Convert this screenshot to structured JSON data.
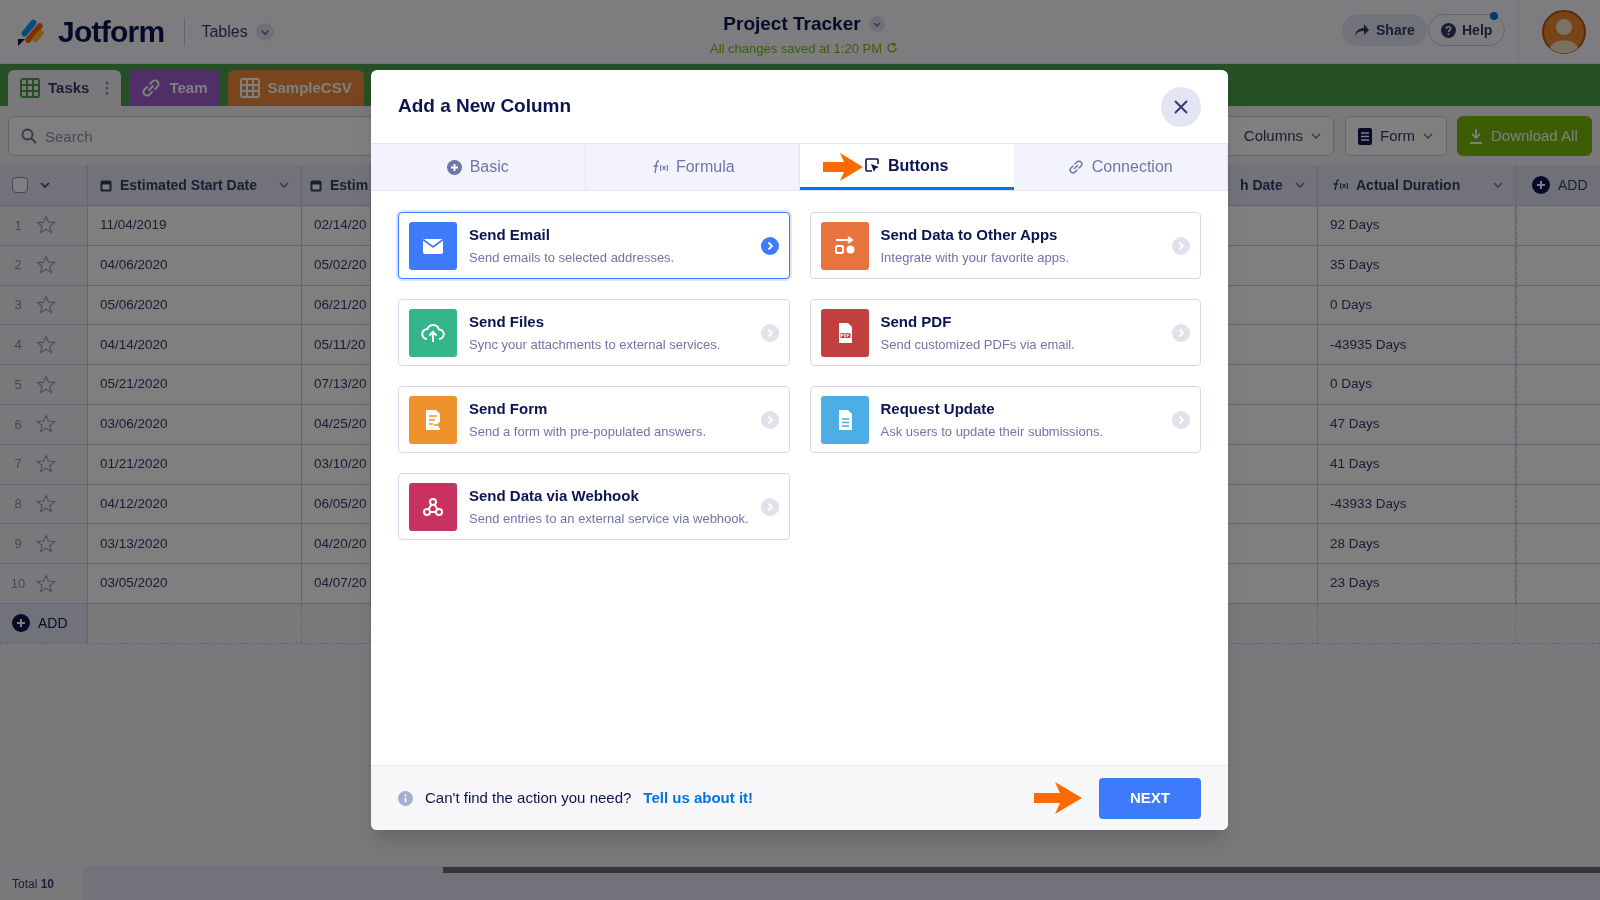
{
  "header": {
    "logo": "Jotform",
    "product": "Tables",
    "title": "Project Tracker",
    "saved": "All changes saved at 1:20 PM",
    "share": "Share",
    "help": "Help",
    "help_notice": true
  },
  "sheet_tabs": [
    {
      "label": "Tasks",
      "kind": "grid",
      "selected": true
    },
    {
      "label": "Team",
      "kind": "link",
      "selected": false
    },
    {
      "label": "SampleCSV",
      "kind": "grid",
      "selected": false
    }
  ],
  "toolbar": {
    "search": {
      "placeholder": "Search"
    },
    "columns": "Columns",
    "form": "Form",
    "download": "Download All"
  },
  "table": {
    "select_all": {
      "checked": false
    },
    "columns": [
      {
        "label": "Estimated Start Date",
        "kind": "date"
      },
      {
        "label": "Estim",
        "kind": "date"
      },
      {
        "label": "h Date",
        "kind": "plain"
      },
      {
        "label": "Actual Duration",
        "kind": "formula"
      }
    ],
    "add_column": "ADD",
    "rows": [
      {
        "number": "1",
        "starred": false,
        "cells": [
          "11/04/2019",
          "02/14/20",
          "",
          "92 Days"
        ]
      },
      {
        "number": "2",
        "starred": false,
        "cells": [
          "04/06/2020",
          "05/02/20",
          "",
          "35 Days"
        ]
      },
      {
        "number": "3",
        "starred": false,
        "cells": [
          "05/06/2020",
          "06/21/20",
          "",
          "0 Days"
        ]
      },
      {
        "number": "4",
        "starred": false,
        "cells": [
          "04/14/2020",
          "05/11/20",
          "",
          "-43935 Days"
        ]
      },
      {
        "number": "5",
        "starred": false,
        "cells": [
          "05/21/2020",
          "07/13/20",
          "",
          "0 Days"
        ]
      },
      {
        "number": "6",
        "starred": false,
        "cells": [
          "03/06/2020",
          "04/25/20",
          "",
          "47 Days"
        ]
      },
      {
        "number": "7",
        "starred": false,
        "cells": [
          "01/21/2020",
          "03/10/20",
          "",
          "41 Days"
        ]
      },
      {
        "number": "8",
        "starred": false,
        "cells": [
          "04/12/2020",
          "06/05/20",
          "",
          "-43933 Days"
        ]
      },
      {
        "number": "9",
        "starred": false,
        "cells": [
          "03/13/2020",
          "04/20/20",
          "",
          "28 Days"
        ]
      },
      {
        "number": "10",
        "starred": false,
        "cells": [
          "03/05/2020",
          "04/07/20",
          "",
          "23 Days"
        ]
      }
    ],
    "add_row": "ADD",
    "total": "Total **10**"
  },
  "modal": {
    "title": "Add a New Column",
    "tabs": [
      {
        "label": "Basic",
        "kind": "plus",
        "selected": false
      },
      {
        "label": "Formula",
        "kind": "formula",
        "selected": false
      },
      {
        "label": "Buttons",
        "kind": "pointer",
        "selected": true
      },
      {
        "label": "Connection",
        "kind": "link",
        "selected": false
      }
    ],
    "actions": [
      {
        "title": "Send Email",
        "description": "Send emails to selected addresses.",
        "kind": "email",
        "color": "#3e7bfa",
        "selected": true
      },
      {
        "title": "Send Data to Other Apps",
        "description": "Integrate with your favorite apps.",
        "kind": "apps",
        "color": "#e8733f",
        "selected": false
      },
      {
        "title": "Send Files",
        "description": "Sync your attachments to external services.",
        "kind": "upload",
        "color": "#35b58c",
        "selected": false
      },
      {
        "title": "Send PDF",
        "description": "Send customized PDFs via email.",
        "kind": "pdf",
        "color": "#c0403f",
        "selected": false
      },
      {
        "title": "Send Form",
        "description": "Send a form with pre-populated answers.",
        "kind": "form",
        "color": "#f0922b",
        "selected": false
      },
      {
        "title": "Request Update",
        "description": "Ask users to update their submissions.",
        "kind": "doc",
        "color": "#4daee6",
        "selected": false
      },
      {
        "title": "Send Data via Webhook",
        "description": "Send entries to an external service via webhook.",
        "kind": "webhook",
        "color": "#c8325e",
        "selected": false
      }
    ],
    "footer_text": "Can't find the action you need?",
    "footer_link": "Tell us about it!",
    "next": "NEXT"
  }
}
